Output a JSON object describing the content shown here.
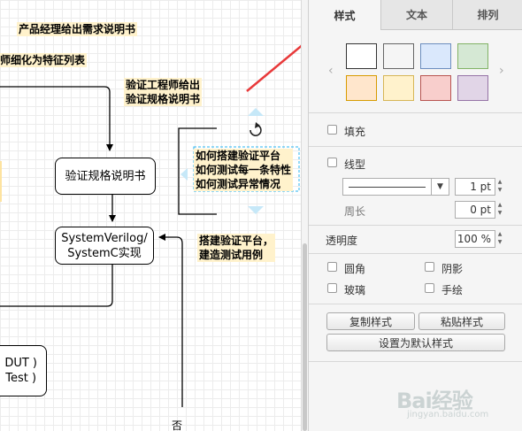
{
  "canvas": {
    "notes": {
      "pm": "产品经理给出需求说明书",
      "refine": "师细化为特征列表",
      "verify_engineer": "验证工程师给出\n验证规格说明书",
      "questions": "如何搭建验证平台\n如何测试每一条特性\n如何测试异常情况",
      "build": "搭建验证平台，\n建造测试用例"
    },
    "nodes": {
      "spec": "验证规格说明书",
      "impl": "SystemVerilog/\nSystemC实现",
      "dut": "DUT )\nTest )"
    },
    "edge_label_no": "否",
    "rotate_icon": "rotate-icon"
  },
  "panel": {
    "tabs": [
      "样式",
      "文本",
      "排列"
    ],
    "active_tab": 0,
    "swatches": {
      "colors": [
        "#ffffff",
        "#f5f5f5",
        "#dae8fc",
        "#d5e8d4",
        "#ffe6cc",
        "#fff2cc",
        "#f8cecc",
        "#e1d5e7"
      ],
      "borders": [
        "#000000",
        "#666666",
        "#6c8ebf",
        "#82b366",
        "#d79b00",
        "#d6b656",
        "#b85450",
        "#9673a6"
      ],
      "selected": 0
    },
    "nav_prev": "‹",
    "nav_next": "›",
    "fill_label": "填充",
    "line_label": "线型",
    "line_width": "1 pt",
    "perimeter_label": "周长",
    "perimeter_value": "0 pt",
    "opacity_label": "透明度",
    "opacity_value": "100 %",
    "rounded_label": "圆角",
    "shadow_label": "阴影",
    "glass_label": "玻璃",
    "sketch_label": "手绘",
    "copy_style": "复制样式",
    "paste_style": "粘贴样式",
    "set_default": "设置为默认样式"
  },
  "watermark": {
    "brand": "Bai经验",
    "url": "jingyan.baidu.com"
  },
  "colors": {
    "note_fill": "#fff2cc",
    "selection": "#29b6f2",
    "arrow": "#e8393a"
  }
}
